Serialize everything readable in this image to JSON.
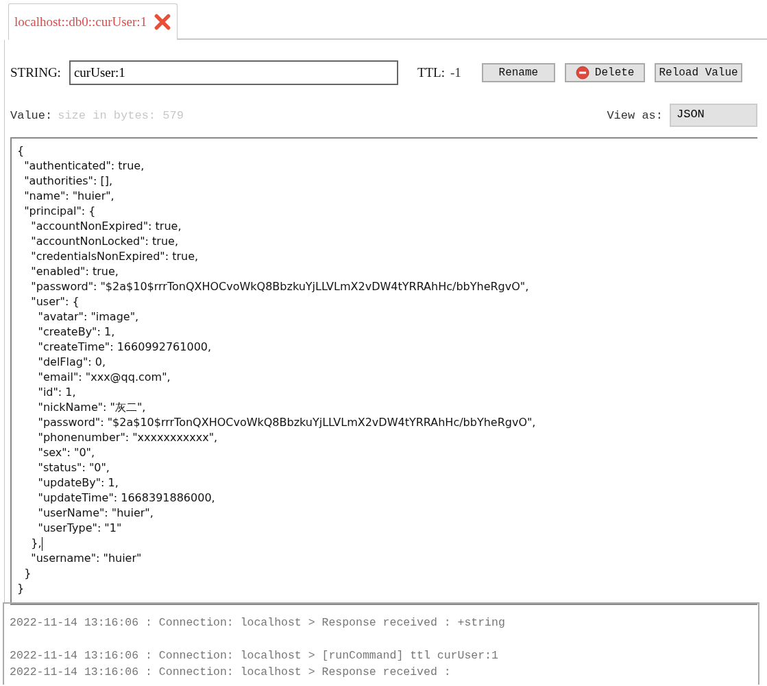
{
  "tab": {
    "title": "localhost::db0::curUser:1",
    "selected": true
  },
  "key": {
    "type_label": "STRING:",
    "value": "curUser:1",
    "ttl_label": "TTL:",
    "ttl": "-1"
  },
  "buttons": [
    {
      "kind": "plain",
      "label": "Rename"
    },
    {
      "kind": "delete",
      "label": "Delete"
    },
    {
      "kind": "plain",
      "label": "Reload Value"
    }
  ],
  "value": {
    "label": "Value:",
    "size_hint": "size in bytes: 579",
    "view_as_label": "View as:",
    "view_as": "JSON"
  },
  "editor_lines": [
    "{",
    "  \"authenticated\": true,",
    "  \"authorities\": [],",
    "  \"name\": \"huier\",",
    "  \"principal\": {",
    "    \"accountNonExpired\": true,",
    "    \"accountNonLocked\": true,",
    "    \"credentialsNonExpired\": true,",
    "    \"enabled\": true,",
    "    \"password\": \"$2a$10$rrrTonQXHOCvoWkQ8BbzkuYjLLVLmX2vDW4tYRRAhHc/bbYheRgvO\",",
    "    \"user\": {",
    "      \"avatar\": \"image\",",
    "      \"createBy\": 1,",
    "      \"createTime\": 1660992761000,",
    "      \"delFlag\": 0,",
    "      \"email\": \"xxx@qq.com\",",
    "      \"id\": 1,",
    "      \"nickName\": \"灰二\",",
    "      \"password\": \"$2a$10$rrrTonQXHOCvoWkQ8BbzkuYjLLVLmX2vDW4tYRRAhHc/bbYheRgvO\",",
    "      \"phonenumber\": \"xxxxxxxxxxx\",",
    "      \"sex\": \"0\",",
    "      \"status\": \"0\",",
    "      \"updateBy\": 1,",
    "      \"updateTime\": 1668391886000,",
    "      \"userName\": \"huier\",",
    "      \"userType\": \"1\"",
    "    },",
    "    \"username\": \"huier\"",
    "  }",
    "}"
  ],
  "log_groups": [
    [
      "2022-11-14 13:16:06 : Connection: localhost > Response received : +string"
    ],
    [
      "2022-11-14 13:16:06 : Connection: localhost > [runCommand] ttl curUser:1",
      "2022-11-14 13:16:06 : Connection: localhost > Response received :"
    ]
  ]
}
